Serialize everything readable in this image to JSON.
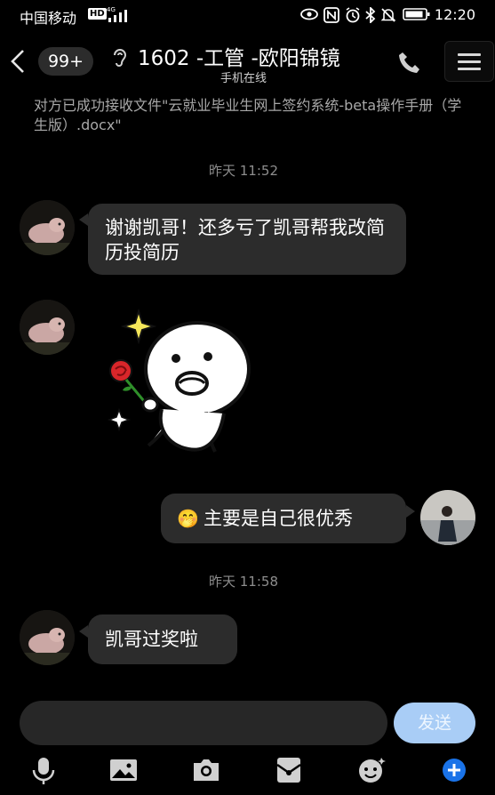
{
  "status_bar": {
    "carrier": "中国移动",
    "hd": "HD",
    "network": "4G",
    "time": "12:20"
  },
  "header": {
    "unread_badge": "99+",
    "title": "1602 -工管 -欧阳锦镜",
    "subtitle": "手机在线"
  },
  "notice": "对方已成功接收文件\"云就业毕业生网上签约系统-beta操作手册（学生版）.docx\"",
  "messages": {
    "time1": "昨天 11:52",
    "msg1": "谢谢凯哥！还多亏了凯哥帮我改简历投简历",
    "msg3_emoji": "🤭",
    "msg3": "主要是自己很优秀",
    "time2": "昨天 11:58",
    "msg4": "凯哥过奖啦"
  },
  "composer": {
    "input_value": "",
    "send_label": "发送"
  },
  "colors": {
    "background": "#000000",
    "bubble": "#2c2c2c",
    "send_button": "#a9cdf6",
    "plus_button": "#1a73e8"
  },
  "toolbar_icons": [
    "microphone-icon",
    "image-icon",
    "camera-icon",
    "red-packet-icon",
    "emoji-icon",
    "plus-icon"
  ]
}
